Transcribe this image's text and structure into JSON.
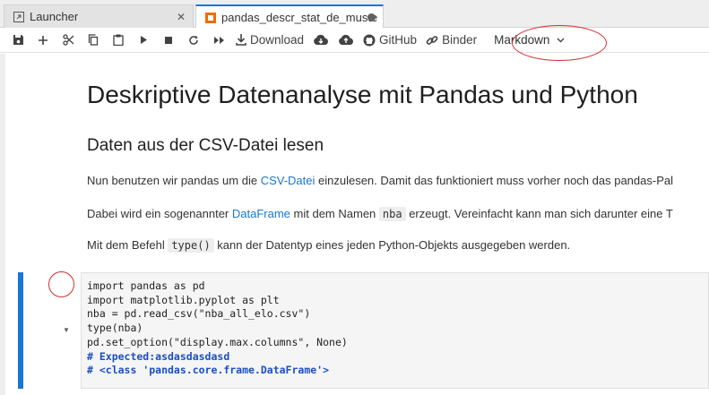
{
  "tabs": [
    {
      "label": "Launcher",
      "icon": "launcher-icon"
    },
    {
      "label": "pandas_descr_stat_de_muste",
      "icon": "notebook-icon"
    }
  ],
  "toolbar": {
    "download_label": "Download",
    "github_label": "GitHub",
    "binder_label": "Binder",
    "cell_type": "Markdown"
  },
  "notebook": {
    "title": "Deskriptive Datenanalyse mit Pandas und Python",
    "section": "Daten aus der CSV-Datei lesen",
    "p1": {
      "before": "Nun benutzen wir pandas um die ",
      "link": "CSV-Datei",
      "after": " einzulesen. Damit das funktioniert muss vorher noch das pandas-Pal"
    },
    "p2": {
      "before": "Dabei wird ein sogenannter ",
      "link": "DataFrame",
      "middle": " mit dem Namen ",
      "code": "nba",
      "after": " erzeugt. Vereinfacht kann man sich darunter eine T"
    },
    "p3": {
      "before": "Mit dem Befehl ",
      "code": "type()",
      "after": " kann der Datentyp eines jeden Python-Objekts ausgegeben werden."
    },
    "code_lines": [
      "import pandas as pd",
      "import matplotlib.pyplot as plt",
      "nba = pd.read_csv(\"nba_all_elo.csv\")",
      "type(nba)",
      "pd.set_option(\"display.max.columns\", None)"
    ],
    "code_comments": [
      "# Expected:asdasdasdasd",
      "# <class 'pandas.core.frame.DataFrame'>"
    ]
  },
  "colors": {
    "accent": "#1976d2",
    "annotation": "#d32f2f"
  }
}
